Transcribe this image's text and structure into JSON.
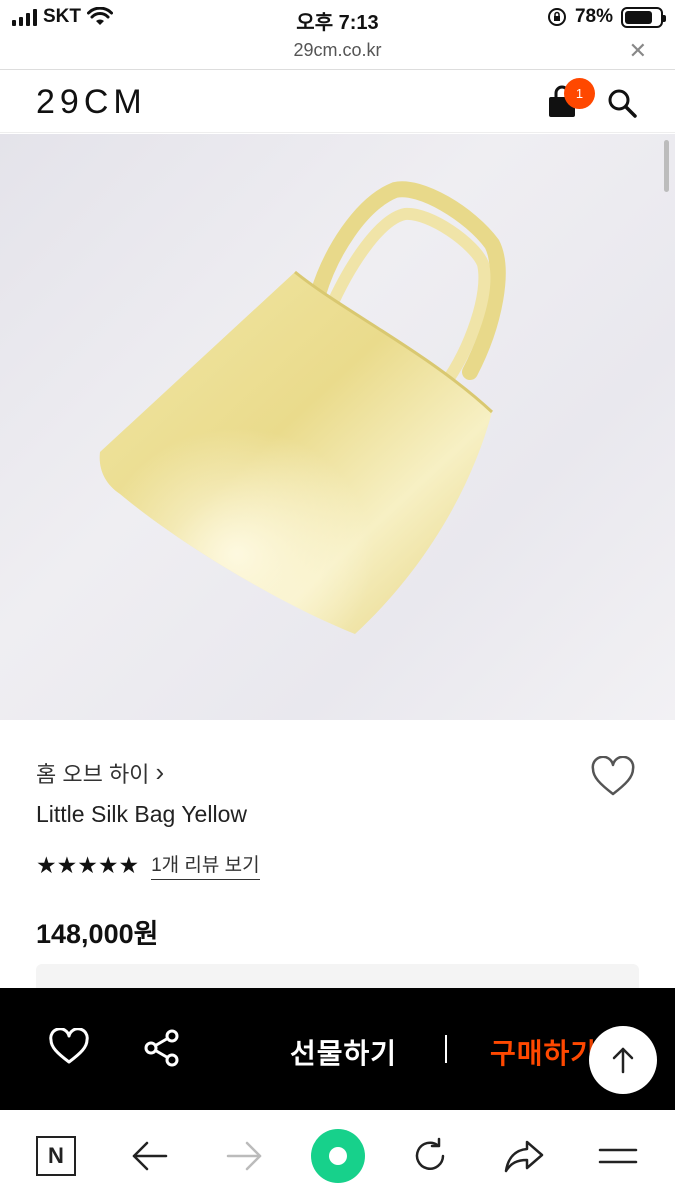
{
  "status_bar": {
    "carrier": "SKT",
    "time": "오후 7:13",
    "battery_percent": "78%",
    "battery_level": 0.78
  },
  "browser": {
    "url": "29cm.co.kr",
    "close_symbol": "✕"
  },
  "header": {
    "logo": "29CM",
    "cart_count": "1"
  },
  "product": {
    "brand": "홈 오브 하이",
    "brand_chevron": "›",
    "name": "Little Silk Bag Yellow",
    "rating_stars": "★★★★★",
    "rating_value": 5,
    "review_link": "1개 리뷰 보기",
    "price": "148,000원"
  },
  "action_bar": {
    "gift_label": "선물하기",
    "buy_label": "구매하기"
  },
  "colors": {
    "accent": "#ff4800",
    "action_bar_bg": "#000000",
    "browser_home": "#17d18b",
    "bag_yellow": "#efe29a"
  },
  "icons": {
    "cart": "shopping-bag-icon",
    "search": "search-icon",
    "wish": "heart-icon",
    "share": "share-icon",
    "scroll_top": "arrow-up-icon",
    "browser": [
      "naver-n-icon",
      "back-arrow-icon",
      "forward-arrow-icon",
      "green-home-icon",
      "refresh-icon",
      "share-arrow-icon",
      "menu-icon"
    ]
  }
}
